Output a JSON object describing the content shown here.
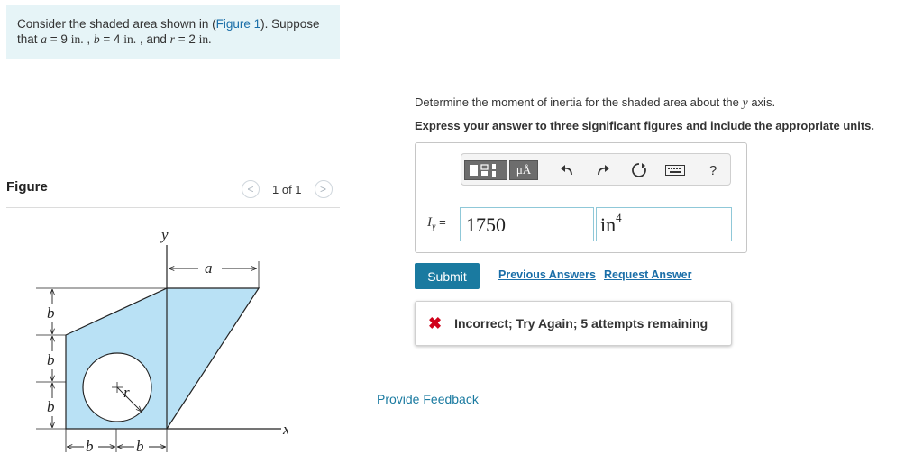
{
  "problem": {
    "text_before": "Consider the shaded area shown in (",
    "figure_link": "Figure 1",
    "text_after": "). Suppose",
    "line2_prefix": "that ",
    "a_var": "a",
    "a_eq": " = 9 ",
    "a_unit": "in.",
    "sep1": " , ",
    "b_var": "b",
    "b_eq": " = 4 ",
    "b_unit": "in.",
    "sep2": " , and ",
    "r_var": "r",
    "r_eq": " = 2 ",
    "r_unit": "in."
  },
  "figure": {
    "title": "Figure",
    "pager_prev": "<",
    "pager_count": "1 of 1",
    "pager_next": ">",
    "labels": {
      "y": "y",
      "x": "x",
      "a": "a",
      "b": "b",
      "r": "r"
    },
    "colors": {
      "fill": "#b9e1f5",
      "stroke": "#222222"
    }
  },
  "question": {
    "text_before": "Determine the moment of inertia for the shaded area about the ",
    "axis": "y",
    "text_after": " axis."
  },
  "instructions": "Express your answer to three significant figures and include the appropriate units.",
  "toolbar": {
    "units_label": "μÅ",
    "undo_icon": "undo-icon",
    "redo_icon": "redo-icon",
    "reset_icon": "reset-icon",
    "keyboard_icon": "keyboard-icon",
    "help_label": "?"
  },
  "answer": {
    "var_name": "I",
    "var_sub": "y",
    "equals": " =",
    "value": "1750",
    "unit_base": "in",
    "unit_exp": "4"
  },
  "buttons": {
    "submit": "Submit",
    "previous_answers": "Previous Answers",
    "request_answer": "Request Answer"
  },
  "feedback": {
    "icon": "✖",
    "message": "Incorrect; Try Again; 5 attempts remaining"
  },
  "provide_feedback": "Provide Feedback",
  "colors": {
    "accent": "#1a7aa0",
    "link": "#1a6ea8",
    "error": "#d0021b",
    "problem_bg": "#e6f4f7",
    "input_border": "#8fc8d8"
  }
}
